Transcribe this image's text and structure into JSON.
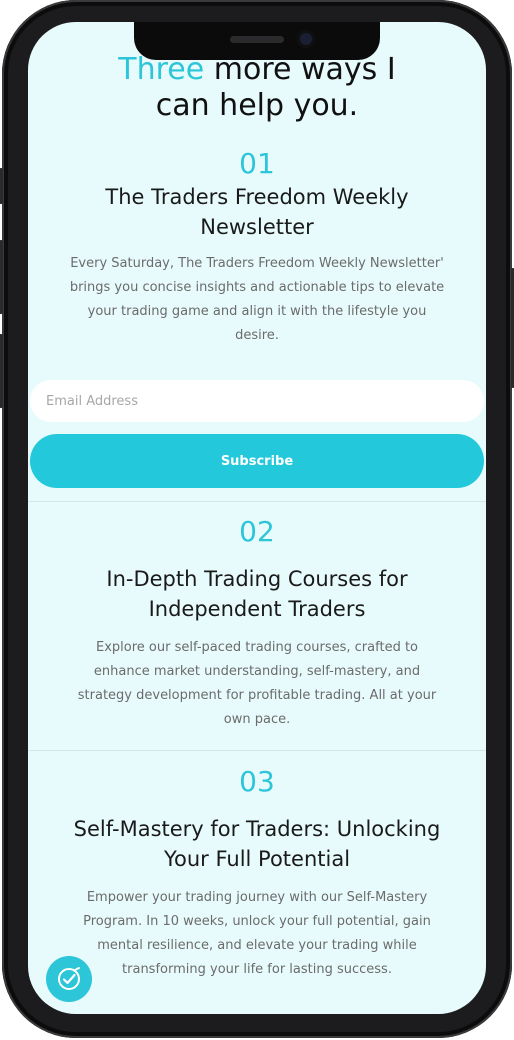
{
  "heading": {
    "accent": "Three",
    "rest_line1": " more ways I",
    "line2": "can help you."
  },
  "sections": [
    {
      "number": "01",
      "title_line1": "The Traders Freedom Weekly",
      "title_line2": "Newsletter",
      "desc_lines": [
        "Every Saturday, The Traders Freedom Weekly Newsletter'",
        "brings you concise insights and actionable tips to elevate",
        "your trading game and align it with the lifestyle you",
        "desire."
      ]
    },
    {
      "number": "02",
      "title_line1": "In-Depth Trading Courses for",
      "title_line2": "Independent Traders",
      "desc_lines": [
        "Explore our self-paced trading courses, crafted to",
        "enhance market understanding, self-mastery, and",
        "strategy development for profitable trading. All at your",
        "own pace."
      ]
    },
    {
      "number": "03",
      "title_line1": "Self-Mastery for Traders: Unlocking",
      "title_line2": "Your Full Potential",
      "desc_lines": [
        "Empower your trading journey with our Self-Mastery",
        "Program. In 10 weeks, unlock your full potential, gain",
        "mental resilience, and elevate your trading while",
        "transforming your life for lasting success."
      ]
    }
  ],
  "form": {
    "email_placeholder": "Email Address",
    "subscribe_label": "Subscribe"
  },
  "colors": {
    "accent": "#2cc6d8",
    "button": "#23c9db",
    "background": "#e8fbfc"
  },
  "icons": {
    "fab": "badge-check-icon"
  }
}
